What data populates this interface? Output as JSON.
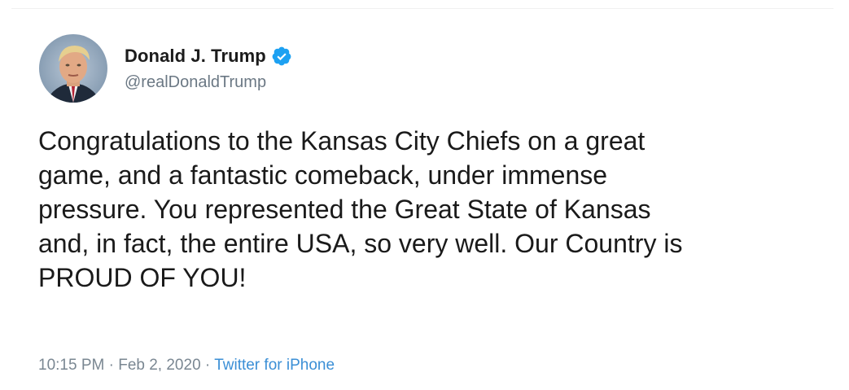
{
  "tweet": {
    "author": {
      "display_name": "Donald J. Trump",
      "handle": "@realDonaldTrump",
      "verified": true,
      "avatar_icon": "profile-photo"
    },
    "text_lines": [
      "Congratulations to the Kansas City Chiefs on a great",
      "game, and a fantastic comeback, under immense",
      "pressure. You represented the Great State of Kansas",
      "and, in fact, the entire USA, so very well. Our Country is",
      "PROUD OF YOU!"
    ],
    "meta": {
      "time": "10:15 PM",
      "separator": " · ",
      "date": "Feb 2, 2020",
      "source": "Twitter for iPhone"
    }
  },
  "colors": {
    "verified_blue": "#1da1f2",
    "link_blue": "#3b8fd6",
    "secondary_text": "#6b7884"
  }
}
